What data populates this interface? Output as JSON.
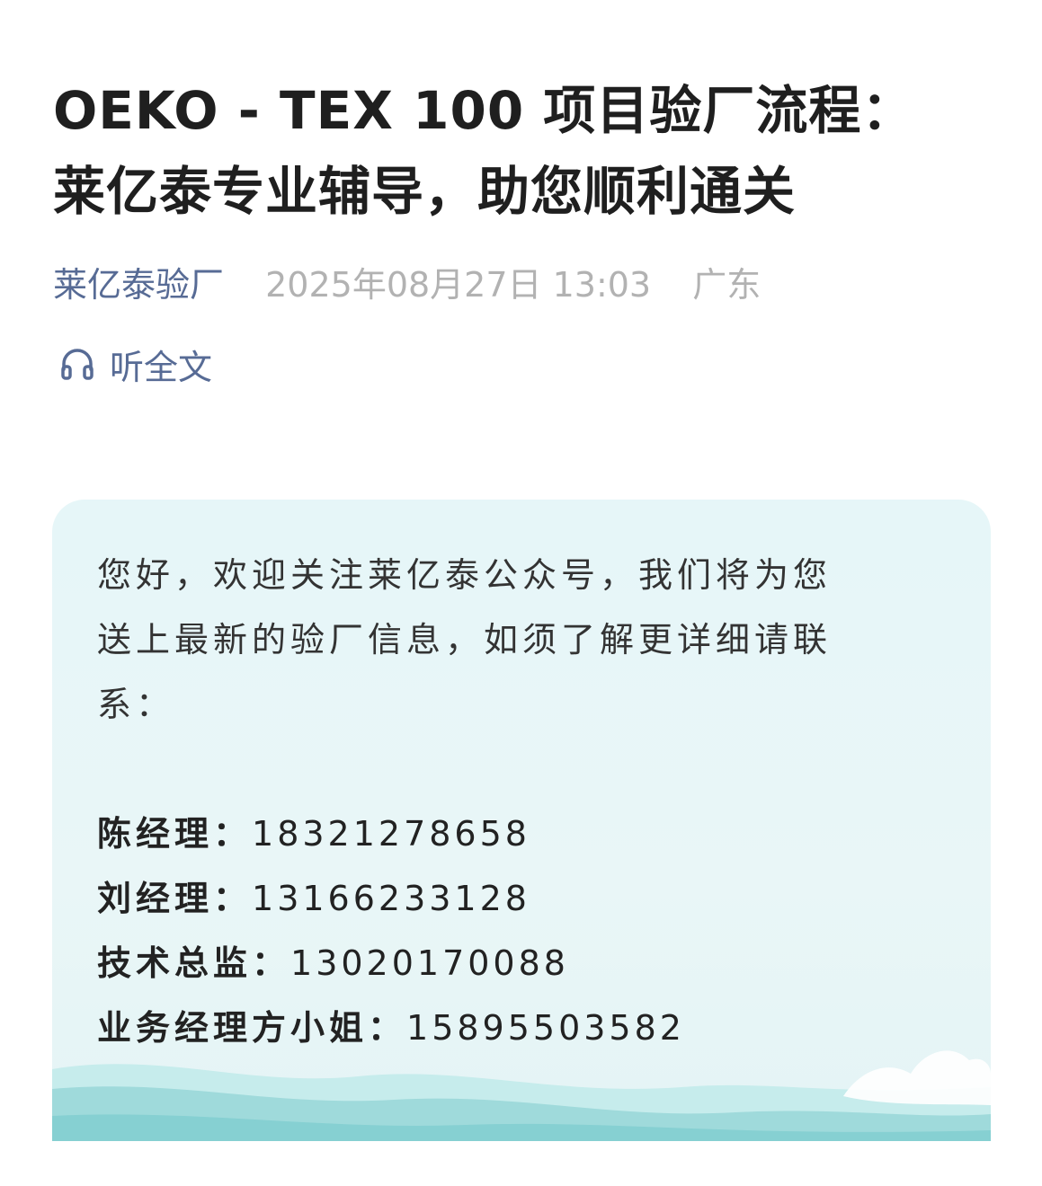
{
  "article": {
    "title_line1": "OEKO - TEX 100 项目验厂流程：",
    "title_line2": "莱亿泰专业辅导，助您顺利通关",
    "author": "莱亿泰验厂",
    "date": "2025年08月27日 13:03",
    "location": "广东"
  },
  "listen": {
    "icon": "headphones-icon",
    "label": "听全文"
  },
  "card": {
    "intro_line1": "您好，欢迎关注莱亿泰公众号，我们将为您",
    "intro_line2": "送上最新的验厂信息，如须了解更详细请联",
    "intro_line3": "系：",
    "contacts": [
      {
        "label": "陈经理：",
        "phone": "18321278658"
      },
      {
        "label": "刘经理：",
        "phone": "13166233128"
      },
      {
        "label": "技术总监：",
        "phone": "13020170088"
      },
      {
        "label": "业务经理方小姐：",
        "phone": "15895503582"
      }
    ]
  },
  "colors": {
    "link": "#576b95",
    "muted": "#b2b2b2",
    "card_bg": "#e6f6f8",
    "wave": "#9fdadb"
  }
}
